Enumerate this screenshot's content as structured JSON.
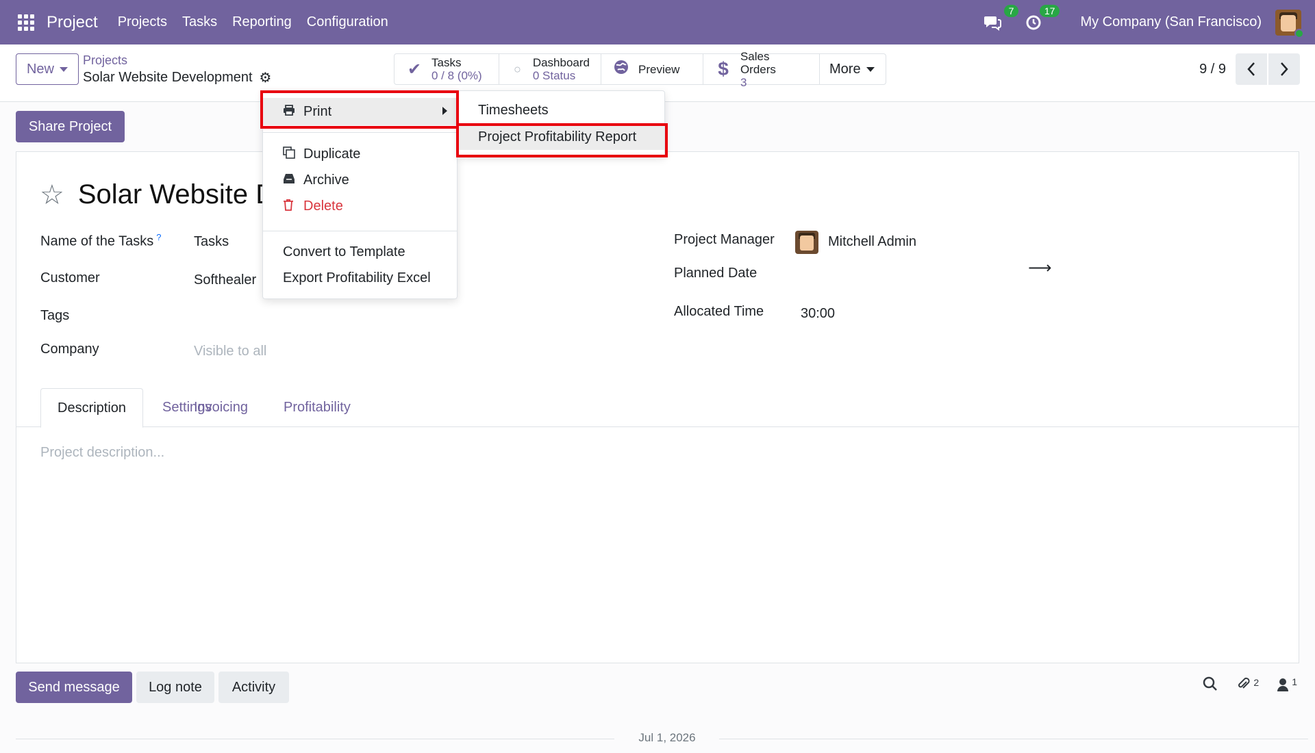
{
  "navbar": {
    "app_name": "Project",
    "menu": [
      "Projects",
      "Tasks",
      "Reporting",
      "Configuration"
    ],
    "messages_count": "7",
    "activities_count": "17",
    "company": "My Company (San Francisco)"
  },
  "control": {
    "new_label": "New",
    "breadcrumb_parent": "Projects",
    "breadcrumb_current": "Solar Website Development",
    "pager_value": "9 / 9"
  },
  "smart_buttons": {
    "tasks": {
      "label": "Tasks",
      "value": "0 / 8 (0%)"
    },
    "dashboard": {
      "label": "Dashboard",
      "value": "0 Status"
    },
    "preview": {
      "label": "Preview"
    },
    "sales_orders": {
      "label": "Sales Orders",
      "value": "3"
    },
    "more": {
      "label": "More"
    }
  },
  "actions": {
    "share_label": "Share Project"
  },
  "form": {
    "title": "Solar Website D",
    "fields": {
      "name_of_tasks_label": "Name of the Tasks",
      "name_of_tasks_help": "?",
      "name_of_tasks_value": "Tasks",
      "customer_label": "Customer",
      "customer_value": "Softhealer",
      "tags_label": "Tags",
      "company_label": "Company",
      "company_placeholder": "Visible to all",
      "project_manager_label": "Project Manager",
      "project_manager_value": "Mitchell Admin",
      "planned_date_label": "Planned Date",
      "allocated_time_label": "Allocated Time",
      "allocated_time_value": "30:00"
    },
    "tabs": [
      "Description",
      "Settings",
      "Invoicing",
      "Profitability"
    ],
    "active_tab": "Description",
    "description_placeholder": "Project description..."
  },
  "action_menu": {
    "print": "Print",
    "duplicate": "Duplicate",
    "archive": "Archive",
    "delete": "Delete",
    "convert_to_template": "Convert to Template",
    "export_profitability_excel": "Export Profitability Excel"
  },
  "print_submenu": {
    "timesheets": "Timesheets",
    "project_profitability_report": "Project Profitability Report"
  },
  "chatter": {
    "send_message": "Send message",
    "log_note": "Log note",
    "activity": "Activity",
    "attachments_count": "2",
    "followers_count": "1",
    "date_separator": "Jul 1, 2026"
  },
  "colors": {
    "brand": "#71639e",
    "highlight": "#e8000d",
    "danger": "#d9363e",
    "badge": "#28a745"
  }
}
